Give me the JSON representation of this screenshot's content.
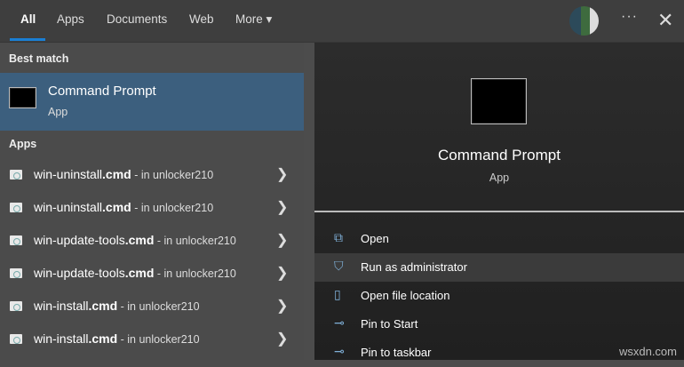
{
  "tabs": [
    {
      "label": "All"
    },
    {
      "label": "Apps"
    },
    {
      "label": "Documents"
    },
    {
      "label": "Web"
    },
    {
      "label": "More ▾"
    }
  ],
  "header_icons": {
    "more": "···",
    "close": "✕"
  },
  "best_match": {
    "header": "Best match",
    "title": "Command Prompt",
    "subtitle": "App"
  },
  "apps": {
    "header": "Apps",
    "items": [
      {
        "name": "win-uninstall",
        "ext": ".cmd",
        "loc": " - in unlocker210"
      },
      {
        "name": "win-uninstall",
        "ext": ".cmd",
        "loc": " - in unlocker210"
      },
      {
        "name": "win-update-tools",
        "ext": ".cmd",
        "loc": " - in unlocker210"
      },
      {
        "name": "win-update-tools",
        "ext": ".cmd",
        "loc": " - in unlocker210"
      },
      {
        "name": "win-install",
        "ext": ".cmd",
        "loc": " - in unlocker210"
      },
      {
        "name": "win-install",
        "ext": ".cmd",
        "loc": " - in unlocker210"
      }
    ]
  },
  "detail": {
    "title": "Command Prompt",
    "subtitle": "App",
    "actions": [
      {
        "label": "Open",
        "icon": "open-icon"
      },
      {
        "label": "Run as administrator",
        "icon": "shield-icon"
      },
      {
        "label": "Open file location",
        "icon": "folder-icon"
      },
      {
        "label": "Pin to Start",
        "icon": "pin-icon"
      },
      {
        "label": "Pin to taskbar",
        "icon": "pin-icon"
      }
    ]
  },
  "watermark": "wsxdn.com",
  "colors": {
    "accent": "#1a7fd4",
    "selected": "#3c5f7e"
  }
}
